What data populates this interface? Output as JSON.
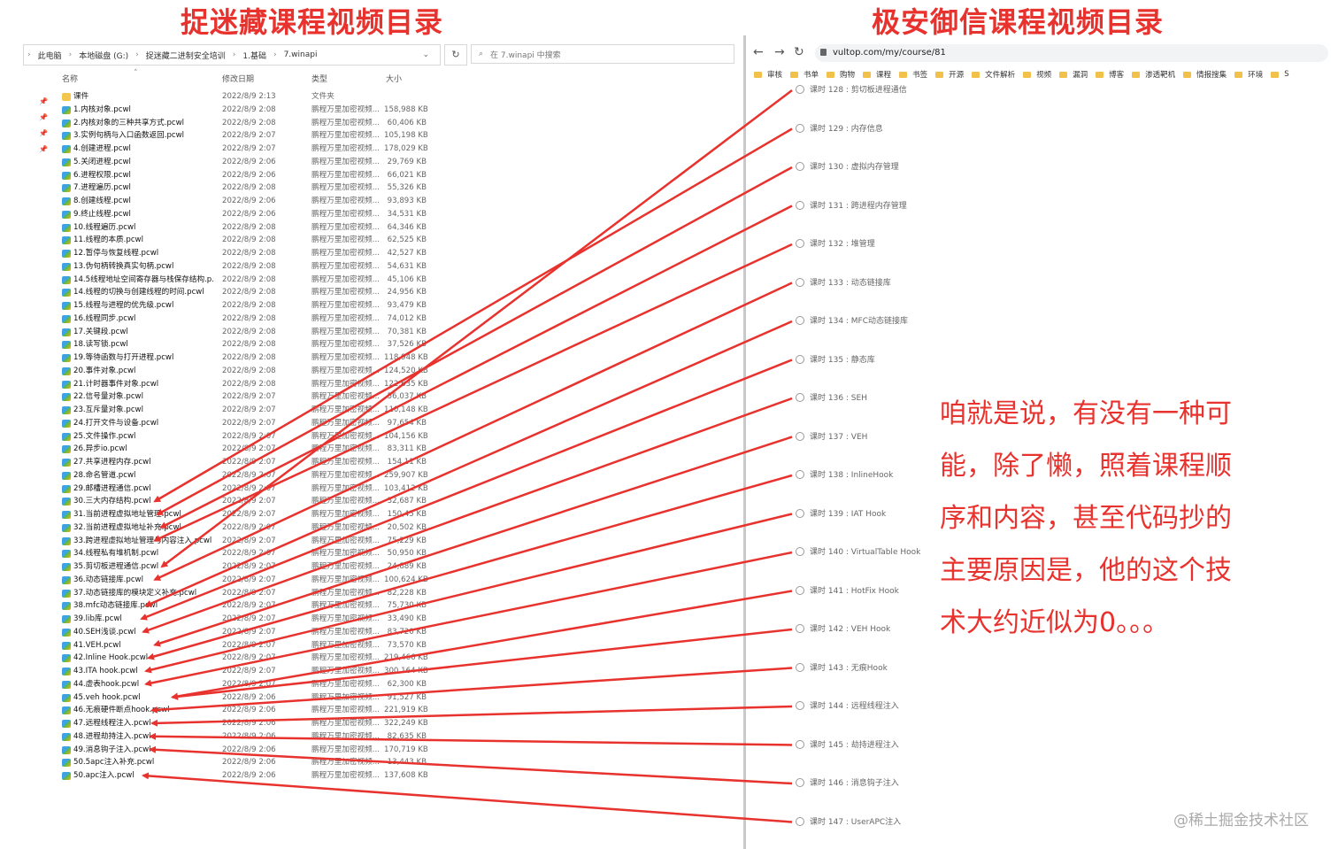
{
  "titles": {
    "left": "捉迷藏课程视频目录",
    "right": "极安御信课程视频目录"
  },
  "explorer": {
    "breadcrumb": [
      "此电脑",
      "本地磁盘 (G:)",
      "捉迷藏二进制安全培训",
      "1.基础",
      "7.winapi"
    ],
    "search_placeholder": "在 7.winapi 中搜索",
    "columns": {
      "name": "名称",
      "date": "修改日期",
      "type": "类型",
      "size": "大小"
    },
    "files": [
      {
        "name": "课件",
        "date": "2022/8/9 2:13",
        "type": "文件夹",
        "size": ""
      },
      {
        "name": "1.内核对象.pcwl",
        "date": "2022/8/9 2:08",
        "type": "鹏程万里加密视频...",
        "size": "158,988 KB"
      },
      {
        "name": "2.内核对象的三种共享方式.pcwl",
        "date": "2022/8/9 2:08",
        "type": "鹏程万里加密视频...",
        "size": "60,406 KB"
      },
      {
        "name": "3.实例句柄与入口函数返回.pcwl",
        "date": "2022/8/9 2:07",
        "type": "鹏程万里加密视频...",
        "size": "105,198 KB"
      },
      {
        "name": "4.创建进程.pcwl",
        "date": "2022/8/9 2:07",
        "type": "鹏程万里加密视频...",
        "size": "178,029 KB"
      },
      {
        "name": "5.关闭进程.pcwl",
        "date": "2022/8/9 2:06",
        "type": "鹏程万里加密视频...",
        "size": "29,769 KB"
      },
      {
        "name": "6.进程权限.pcwl",
        "date": "2022/8/9 2:06",
        "type": "鹏程万里加密视频...",
        "size": "66,021 KB"
      },
      {
        "name": "7.进程遍历.pcwl",
        "date": "2022/8/9 2:08",
        "type": "鹏程万里加密视频...",
        "size": "55,326 KB"
      },
      {
        "name": "8.创建线程.pcwl",
        "date": "2022/8/9 2:06",
        "type": "鹏程万里加密视频...",
        "size": "93,893 KB"
      },
      {
        "name": "9.终止线程.pcwl",
        "date": "2022/8/9 2:06",
        "type": "鹏程万里加密视频...",
        "size": "34,531 KB"
      },
      {
        "name": "10.线程遍历.pcwl",
        "date": "2022/8/9 2:08",
        "type": "鹏程万里加密视频...",
        "size": "64,346 KB"
      },
      {
        "name": "11.线程的本质.pcwl",
        "date": "2022/8/9 2:08",
        "type": "鹏程万里加密视频...",
        "size": "62,525 KB"
      },
      {
        "name": "12.暂停与恢复线程.pcwl",
        "date": "2022/8/9 2:08",
        "type": "鹏程万里加密视频...",
        "size": "42,527 KB"
      },
      {
        "name": "13.伪句柄转换真实句柄.pcwl",
        "date": "2022/8/9 2:08",
        "type": "鹏程万里加密视频...",
        "size": "54,631 KB"
      },
      {
        "name": "14.5线程地址空间寄存器与栈保存结构.p...",
        "date": "2022/8/9 2:08",
        "type": "鹏程万里加密视频...",
        "size": "45,106 KB"
      },
      {
        "name": "14.线程的切换与创建线程的时间.pcwl",
        "date": "2022/8/9 2:08",
        "type": "鹏程万里加密视频...",
        "size": "24,956 KB"
      },
      {
        "name": "15.线程与进程的优先级.pcwl",
        "date": "2022/8/9 2:08",
        "type": "鹏程万里加密视频...",
        "size": "93,479 KB"
      },
      {
        "name": "16.线程同步.pcwl",
        "date": "2022/8/9 2:08",
        "type": "鹏程万里加密视频...",
        "size": "74,012 KB"
      },
      {
        "name": "17.关键段.pcwl",
        "date": "2022/8/9 2:08",
        "type": "鹏程万里加密视频...",
        "size": "70,381 KB"
      },
      {
        "name": "18.读写锁.pcwl",
        "date": "2022/8/9 2:08",
        "type": "鹏程万里加密视频...",
        "size": "37,526 KB"
      },
      {
        "name": "19.等待函数与打开进程.pcwl",
        "date": "2022/8/9 2:08",
        "type": "鹏程万里加密视频...",
        "size": "118,948 KB"
      },
      {
        "name": "20.事件对象.pcwl",
        "date": "2022/8/9 2:08",
        "type": "鹏程万里加密视频...",
        "size": "124,520 KB"
      },
      {
        "name": "21.计时器事件对象.pcwl",
        "date": "2022/8/9 2:08",
        "type": "鹏程万里加密视频...",
        "size": "122,6​35 KB"
      },
      {
        "name": "22.信号量对象.pcwl",
        "date": "2022/8/9 2:07",
        "type": "鹏程万里加密视频...",
        "size": "56,037 KB"
      },
      {
        "name": "23.互斥量对象.pcwl",
        "date": "2022/8/9 2:07",
        "type": "鹏程万里加密视频...",
        "size": "110,148 KB"
      },
      {
        "name": "24.打开文件与设备.pcwl",
        "date": "2022/8/9 2:07",
        "type": "鹏程万里加密视频...",
        "size": "97,654 KB"
      },
      {
        "name": "25.文件操作.pcwl",
        "date": "2022/8/9 2:07",
        "type": "鹏程万里加密视频...",
        "size": "104,156 KB"
      },
      {
        "name": "26.异步io.pcwl",
        "date": "2022/8/9 2:07",
        "type": "鹏程万里加密视频...",
        "size": "83,311 KB"
      },
      {
        "name": "27.共享进程内存.pcwl",
        "date": "2022/8/9 2:07",
        "type": "鹏程万里加密视频...",
        "size": "154,1​1 KB"
      },
      {
        "name": "28.命名管道.pcwl",
        "date": "2022/8/9 2:07",
        "type": "鹏程万里加密视频...",
        "size": "259,907 KB"
      },
      {
        "name": "29.邮槽进程通信.pcwl",
        "date": "2022/8/9 2:07",
        "type": "鹏程万里加密视频...",
        "size": "103,412 KB"
      },
      {
        "name": "30.三大内存结构.pcwl",
        "date": "2022/8/9 2:07",
        "type": "鹏程万里加密视频...",
        "size": "32,687 KB"
      },
      {
        "name": "31.当前进程虚拟地址管理.pcwl",
        "date": "2022/8/9 2:07",
        "type": "鹏程万里加密视频...",
        "size": "150,4​5 KB"
      },
      {
        "name": "32.当前进程虚拟地址补充.pcwl",
        "date": "2022/8/9 2:07",
        "type": "鹏程万里加密视频...",
        "size": "20,502 KB"
      },
      {
        "name": "33.跨进程虚拟地址管理与内容注入.pcwl",
        "date": "2022/8/9 2:07",
        "type": "鹏程万里加密视频...",
        "size": "75,229 KB"
      },
      {
        "name": "34.线程私有堆机制.pcwl",
        "date": "2022/8/9 2:07",
        "type": "鹏程万里加密视频...",
        "size": "50,950 KB"
      },
      {
        "name": "35.剪切板进程通信.pcwl",
        "date": "2022/8/9 2:07",
        "type": "鹏程万里加密视频...",
        "size": "24,889 KB"
      },
      {
        "name": "36.动态链接库.pcwl",
        "date": "2022/8/9 2:07",
        "type": "鹏程万里加密视频...",
        "size": "100,624 KB"
      },
      {
        "name": "37.动态链接库的模块定义补充.pcwl",
        "date": "2022/8/9 2:07",
        "type": "鹏程万里加密视频...",
        "size": "82,228 KB"
      },
      {
        "name": "38.mfc动态链接库.pcwl",
        "date": "2022/8/9 2:07",
        "type": "鹏程万里加密视频...",
        "size": "75,730 KB"
      },
      {
        "name": "39.lib库.pcwl",
        "date": "2022/8/9 2:07",
        "type": "鹏程万里加密视频...",
        "size": "33,490 KB"
      },
      {
        "name": "40.SEH浅谈.pcwl",
        "date": "2022/8/9 2:07",
        "type": "鹏程万里加密视频...",
        "size": "83,720 KB"
      },
      {
        "name": "41.VEH.pcwl",
        "date": "2022/8/9 2:07",
        "type": "鹏程万里加密视频...",
        "size": "73,570 KB"
      },
      {
        "name": "42.Inline Hook.pcwl",
        "date": "2022/8/9 2:07",
        "type": "鹏程万里加密视频...",
        "size": "219,466 KB"
      },
      {
        "name": "43.ITA hook.pcwl",
        "date": "2022/8/9 2:07",
        "type": "鹏程万里加密视频...",
        "size": "300,164 KB"
      },
      {
        "name": "44.虚表hook.pcwl",
        "date": "2022/8/9 2:07",
        "type": "鹏程万里加密视频...",
        "size": "62,300 KB"
      },
      {
        "name": "45.veh hook.pcwl",
        "date": "2022/8/9 2:06",
        "type": "鹏程万里加密视频...",
        "size": "91,527 KB"
      },
      {
        "name": "46.无痕硬件断点hook.pcwl",
        "date": "2022/8/9 2:06",
        "type": "鹏程万里加密视频...",
        "size": "221,919 KB"
      },
      {
        "name": "47.远程线程注入.pcwl",
        "date": "2022/8/9 2:06",
        "type": "鹏程万里加密视频...",
        "size": "322,249 KB"
      },
      {
        "name": "48.进程劫持注入.pcwl",
        "date": "2022/8/9 2:06",
        "type": "鹏程万里加密视频...",
        "size": "82,635 KB"
      },
      {
        "name": "49.消息钩子注入.pcwl",
        "date": "2022/8/9 2:06",
        "type": "鹏程万里加密视频...",
        "size": "170,719 KB"
      },
      {
        "name": "50.5apc注入补充.pcwl",
        "date": "2022/8/9 2:06",
        "type": "鹏程万里加密视频...",
        "size": "13,443 KB"
      },
      {
        "name": "50.apc注入.pcwl",
        "date": "2022/8/9 2:06",
        "type": "鹏程万里加密视频...",
        "size": "137,608 KB"
      }
    ]
  },
  "browser": {
    "url": "vultop.com/my/course/81",
    "bookmarks": [
      "审核",
      "书单",
      "购物",
      "课程",
      "书签",
      "开源",
      "文件解析",
      "视频",
      "漏洞",
      "博客",
      "渗透靶机",
      "情报搜集",
      "环境",
      "S"
    ],
    "lessons": [
      "课时 128 : 剪切板进程通信",
      "课时 129 : 内存信息",
      "课时 130 : 虚拟内存管理",
      "课时 131 : 跨进程内存管理",
      "课时 132 : 堆管理",
      "课时 133 : 动态链接库",
      "课时 134 : MFC动态链接库",
      "课时 135 : 静态库",
      "课时 136 : SEH",
      "课时 137 : VEH",
      "课时 138 : InlineHook",
      "课时 139 : IAT Hook",
      "课时 140 : VirtualTable Hook",
      "课时 141 : HotFix Hook",
      "课时 142 : VEH Hook",
      "课时 143 : 无痕Hook",
      "课时 144 : 远程线程注入",
      "课时 145 : 劫持进程注入",
      "课时 146 : 消息钩子注入",
      "课时 147 : UserAPC注入"
    ]
  },
  "note": [
    "咱就是说，有没有一种可",
    "能，除了懒，照着课程顺",
    "序和内容，甚至代码抄的",
    "主要原因是，他的这个技",
    "术大约近似为0。。。"
  ],
  "watermark": "@稀土掘金技术社区",
  "colors": {
    "accent_red": "#e8322e",
    "arrow_red": "#e8322e"
  }
}
